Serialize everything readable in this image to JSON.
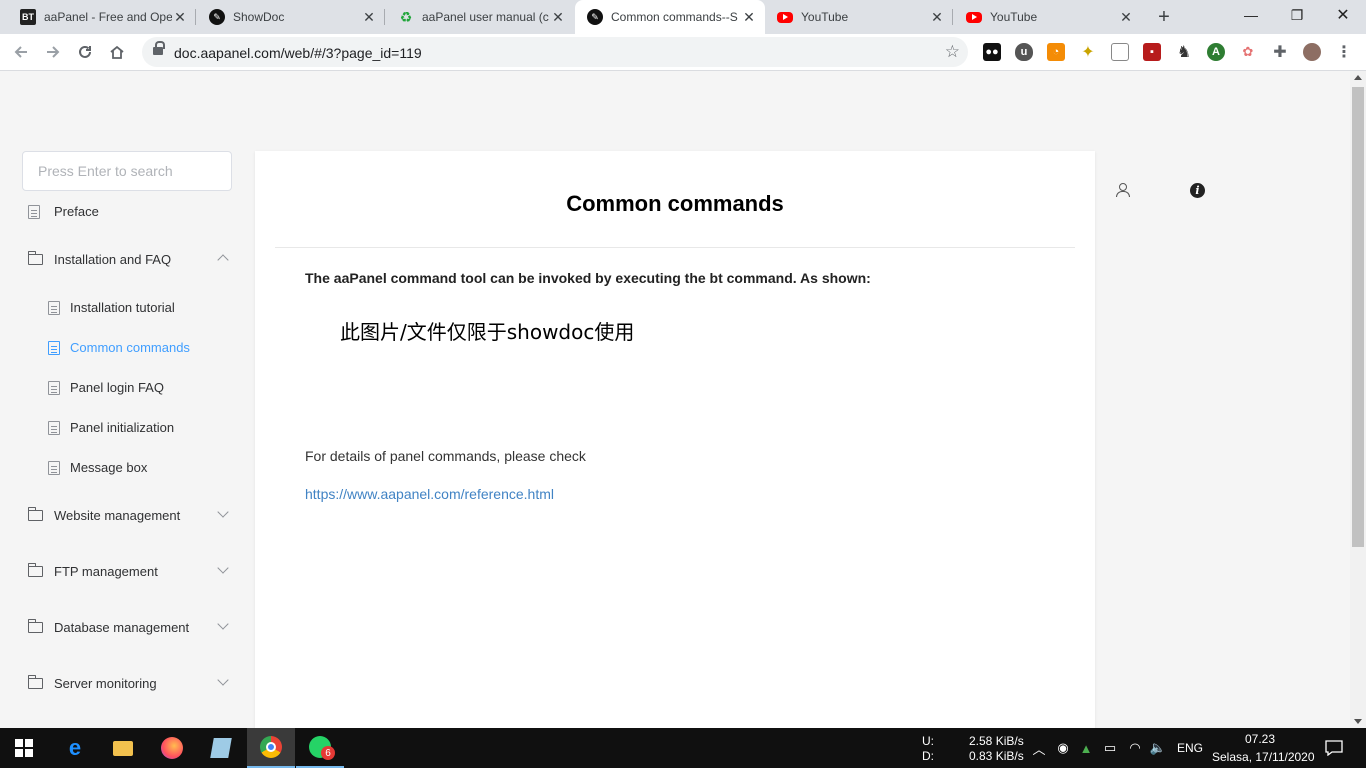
{
  "browser": {
    "tabs": [
      {
        "title": "aaPanel - Free and Ope",
        "favicon": "BT",
        "icon": "aapanel-bt-icon"
      },
      {
        "title": "ShowDoc",
        "favicon": "",
        "icon": "showdoc-icon"
      },
      {
        "title": "aaPanel user manual (c",
        "favicon": "",
        "icon": "aapanel-icon"
      },
      {
        "title": "Common commands--S",
        "favicon": "",
        "icon": "showdoc-icon"
      },
      {
        "title": "YouTube",
        "favicon": "",
        "icon": "youtube-icon"
      },
      {
        "title": "YouTube",
        "favicon": "",
        "icon": "youtube-icon"
      }
    ],
    "active_tab_index": 3,
    "url": "doc.aapanel.com/web/#/3?page_id=119",
    "window_controls": {
      "minimize": "—",
      "restore": "❐",
      "close": "✕"
    },
    "new_tab": "+",
    "menu": "⋮"
  },
  "sidebar": {
    "search_placeholder": "Press Enter to search",
    "items": [
      {
        "label": "Preface",
        "type": "doc",
        "level": 0
      },
      {
        "label": "Installation and FAQ",
        "type": "folder",
        "level": 0,
        "expanded": true
      },
      {
        "label": "Installation tutorial",
        "type": "doc",
        "level": 1
      },
      {
        "label": "Common commands",
        "type": "doc",
        "level": 1,
        "active": true
      },
      {
        "label": "Panel login FAQ",
        "type": "doc",
        "level": 1
      },
      {
        "label": "Panel initialization",
        "type": "doc",
        "level": 1
      },
      {
        "label": "Message box",
        "type": "doc",
        "level": 1
      },
      {
        "label": "Website management",
        "type": "folder",
        "level": 0,
        "expanded": false
      },
      {
        "label": "FTP management",
        "type": "folder",
        "level": 0,
        "expanded": false
      },
      {
        "label": "Database management",
        "type": "folder",
        "level": 0,
        "expanded": false
      },
      {
        "label": "Server monitoring",
        "type": "folder",
        "level": 0,
        "expanded": false
      }
    ]
  },
  "doc": {
    "title": "Common commands",
    "intro": "The aaPanel command tool can be invoked by executing the bt command. As shown:",
    "image_placeholder": "此图片/文件仅限于showdoc使用",
    "details_text": "For details of panel commands, please check",
    "reference_link": "https://www.aapanel.com/reference.html"
  },
  "taskbar": {
    "whatsapp_badge": "6",
    "net_upload_label": "U:",
    "net_download_label": "D:",
    "net_upload": "2.58 KiB/s",
    "net_download": "0.83 KiB/s",
    "language": "ENG",
    "time": "07.23",
    "date": "Selasa, 17/11/2020"
  },
  "colors": {
    "accent": "#409eff",
    "link": "#4183c4",
    "taskbar": "#101010"
  }
}
